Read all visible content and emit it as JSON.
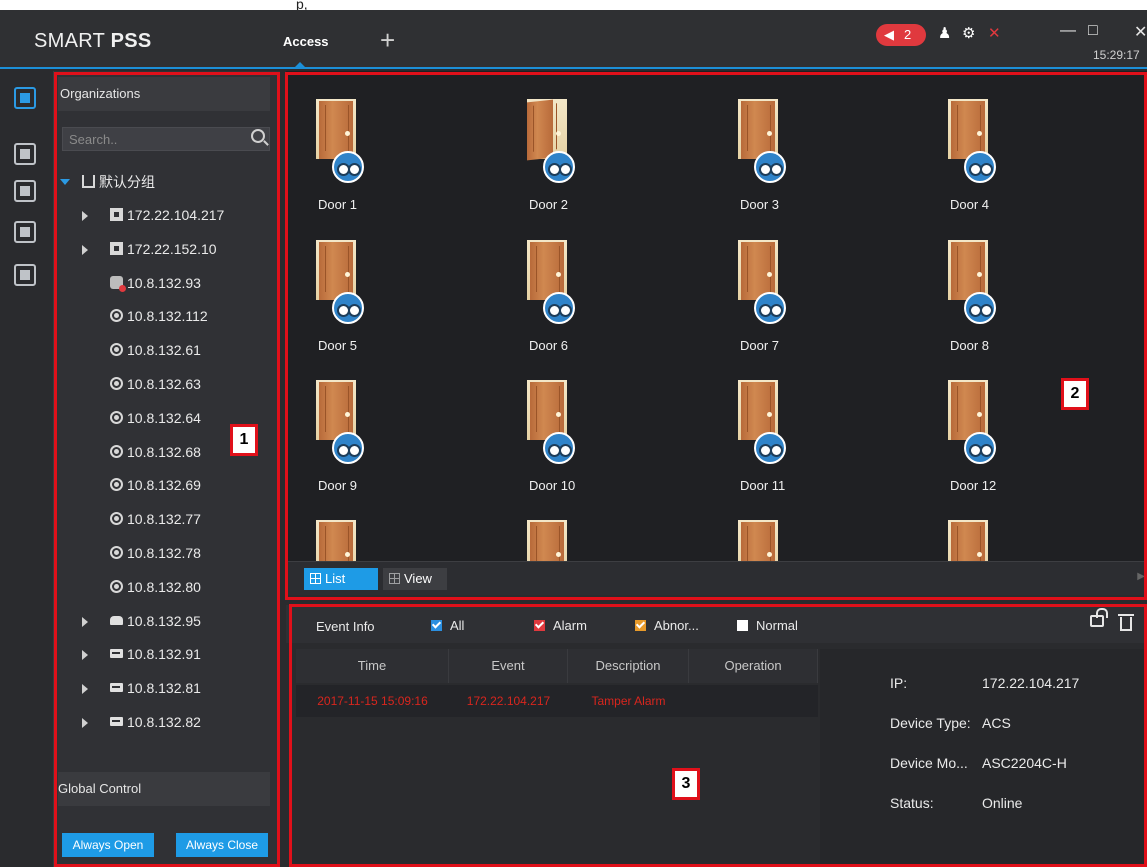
{
  "app": {
    "title_light": "SMART ",
    "title_bold": "PSS",
    "active_tab": "Access",
    "add_tab_glyph": "+",
    "alarm_count": "2",
    "clock": "15:29:17",
    "top_strip_text": "p,"
  },
  "rail": {
    "items": [
      "access-icon",
      "person-card-icon",
      "user-lock-icon",
      "door-report-icon",
      "calendar-icon"
    ]
  },
  "left": {
    "header": "Organizations",
    "search_placeholder": "Search..",
    "root_group": "默认分组",
    "devices": [
      {
        "label": "172.22.104.217",
        "type": "dev",
        "caret": true
      },
      {
        "label": "172.22.152.10",
        "type": "dev",
        "caret": true
      },
      {
        "label": "10.8.132.93",
        "type": "off",
        "caret": false
      },
      {
        "label": "10.8.132.112",
        "type": "cam",
        "caret": false
      },
      {
        "label": "10.8.132.61",
        "type": "cam",
        "caret": false
      },
      {
        "label": "10.8.132.63",
        "type": "cam",
        "caret": false
      },
      {
        "label": "10.8.132.64",
        "type": "cam",
        "caret": false
      },
      {
        "label": "10.8.132.68",
        "type": "cam",
        "caret": false
      },
      {
        "label": "10.8.132.69",
        "type": "cam",
        "caret": false
      },
      {
        "label": "10.8.132.77",
        "type": "cam",
        "caret": false
      },
      {
        "label": "10.8.132.78",
        "type": "cam",
        "caret": false
      },
      {
        "label": "10.8.132.80",
        "type": "cam",
        "caret": false
      },
      {
        "label": "10.8.132.95",
        "type": "nvr",
        "caret": true
      },
      {
        "label": "10.8.132.91",
        "type": "dvr",
        "caret": true
      },
      {
        "label": "10.8.132.81",
        "type": "dvr",
        "caret": true
      },
      {
        "label": "10.8.132.82",
        "type": "dvr",
        "caret": true
      }
    ],
    "global_header": "Global Control",
    "always_open": "Always Open",
    "always_close": "Always Close"
  },
  "doors": {
    "items": [
      {
        "label": "Door 1",
        "open": false
      },
      {
        "label": "Door 2",
        "open": true
      },
      {
        "label": "Door 3",
        "open": false
      },
      {
        "label": "Door 4",
        "open": false
      },
      {
        "label": "Door 5",
        "open": false
      },
      {
        "label": "Door 6",
        "open": false
      },
      {
        "label": "Door 7",
        "open": false
      },
      {
        "label": "Door 8",
        "open": false
      },
      {
        "label": "Door 9",
        "open": false
      },
      {
        "label": "Door 10",
        "open": false
      },
      {
        "label": "Door 11",
        "open": false
      },
      {
        "label": "Door 12",
        "open": false
      },
      {
        "label": "",
        "open": false
      },
      {
        "label": "",
        "open": false
      },
      {
        "label": "",
        "open": false
      },
      {
        "label": "",
        "open": false
      }
    ],
    "list_btn": "List",
    "view_btn": "View"
  },
  "events": {
    "title": "Event Info",
    "filters": [
      {
        "label": "All",
        "color": "#2b8fe0"
      },
      {
        "label": "Alarm",
        "color": "#e0393e"
      },
      {
        "label": "Abnor...",
        "color": "#e89a2a"
      },
      {
        "label": "Normal",
        "color": "#ffffff"
      }
    ],
    "columns": [
      "Time",
      "Event",
      "Description",
      "Operation"
    ],
    "rows": [
      [
        "2017-11-15 15:09:16",
        "172.22.104.217",
        "Tamper Alarm",
        ""
      ]
    ],
    "details": [
      {
        "key": "IP:",
        "value": "172.22.104.217"
      },
      {
        "key": "Device Type:",
        "value": "ACS"
      },
      {
        "key": "Device Mo...",
        "value": "ASC2204C-H"
      },
      {
        "key": "Status:",
        "value": "Online"
      }
    ]
  },
  "annotations": [
    "1",
    "2",
    "3"
  ]
}
